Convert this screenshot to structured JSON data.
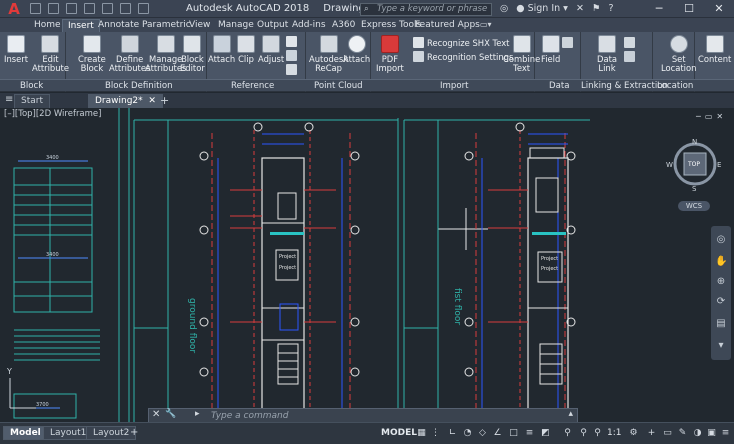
{
  "app": {
    "logo_letter": "A",
    "title": "Autodesk AutoCAD 2018",
    "document": "Drawing2.dwg"
  },
  "search": {
    "placeholder": "Type a keyword or phrase"
  },
  "user": {
    "signin": "Sign In"
  },
  "ribbon_tabs": [
    "Home",
    "Insert",
    "Annotate",
    "Parametric",
    "View",
    "Manage",
    "Output",
    "Add-ins",
    "A360",
    "Express Tools",
    "Featured Apps"
  ],
  "active_tab": "Insert",
  "ribbon": {
    "insert": "Insert",
    "edit_attribute": [
      "Edit",
      "Attribute"
    ],
    "create_block": [
      "Create",
      "Block"
    ],
    "define_attributes": [
      "Define",
      "Attributes"
    ],
    "manage_attributes": [
      "Manage",
      "Attributes"
    ],
    "block_editor": [
      "Block",
      "Editor"
    ],
    "attach": "Attach",
    "clip": "Clip",
    "adjust": "Adjust",
    "autodesk_recap": [
      "Autodesk",
      "ReCap"
    ],
    "attach_pc": "Attach",
    "pdf_import": [
      "PDF",
      "Import"
    ],
    "recognize_shx": "Recognize SHX Text",
    "recognition_settings": "Recognition Settings",
    "combine_text": [
      "Combine",
      "Text"
    ],
    "field": "Field",
    "data_link": [
      "Data",
      "Link"
    ],
    "set_location": [
      "Set",
      "Location"
    ],
    "content": "Content"
  },
  "panel_labels": {
    "block": "Block",
    "block_definition": "Block Definition",
    "reference": "Reference",
    "point_cloud": "Point Cloud",
    "import": "Import",
    "data": "Data",
    "linking": "Linking & Extraction",
    "location": "Location"
  },
  "doc_tabs": {
    "start": "Start",
    "drawing": "Drawing2*"
  },
  "viewport_label": "[–][Top][2D Wireframe]",
  "drawing_text": {
    "ground_floor": "ground floor",
    "first_floor": "fist floor",
    "project": "Project",
    "dim_3400": "3400",
    "dim_3700": "3700"
  },
  "viewcube": {
    "top": "TOP",
    "n": "N",
    "s": "S",
    "e": "E",
    "w": "W",
    "wcs": "WCS"
  },
  "command": {
    "placeholder": "Type a command"
  },
  "layout_tabs": [
    "Model",
    "Layout1",
    "Layout2"
  ],
  "status": {
    "model": "MODEL",
    "scale": "1:1"
  },
  "colors": {
    "accent": "#e03a3a",
    "bg": "#212830",
    "ribbon": "#4a5566"
  }
}
